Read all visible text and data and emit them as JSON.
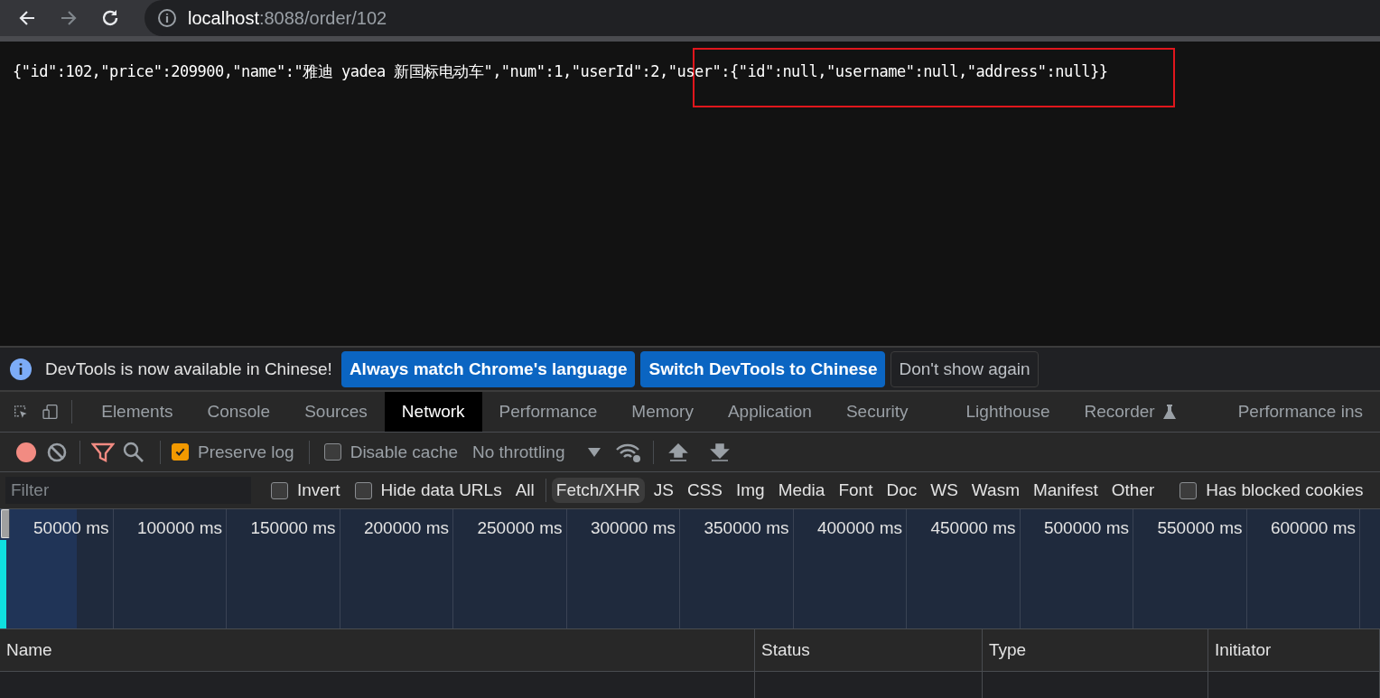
{
  "browser": {
    "address": {
      "host": "localhost",
      "path": ":8088/order/102"
    }
  },
  "page": {
    "response_text": "{\"id\":102,\"price\":209900,\"name\":\"雅迪 yadea 新国标电动车\",\"num\":1,\"userId\":2,\"user\":{\"id\":null,\"username\":null,\"address\":null}}"
  },
  "devtools": {
    "infobar": {
      "message": "DevTools is now available in Chinese!",
      "buttons": [
        {
          "label": "Always match Chrome's language",
          "kind": "primary"
        },
        {
          "label": "Switch DevTools to Chinese",
          "kind": "primary"
        },
        {
          "label": "Don't show again",
          "kind": "secondary"
        }
      ]
    },
    "tabs": [
      {
        "label": "Elements",
        "selected": false
      },
      {
        "label": "Console",
        "selected": false
      },
      {
        "label": "Sources",
        "selected": false
      },
      {
        "label": "Network",
        "selected": true
      },
      {
        "label": "Performance",
        "selected": false
      },
      {
        "label": "Memory",
        "selected": false
      },
      {
        "label": "Application",
        "selected": false
      },
      {
        "label": "Security",
        "selected": false
      },
      {
        "label": "Lighthouse",
        "selected": false
      },
      {
        "label": "Recorder",
        "selected": false,
        "experimental": true
      },
      {
        "label": "Performance ins",
        "selected": false
      }
    ],
    "toolbar": {
      "recording": true,
      "filter_shown": true,
      "preserve_log": {
        "label": "Preserve log",
        "checked": true
      },
      "disable_cache": {
        "label": "Disable cache",
        "checked": false
      },
      "throttling": "No throttling"
    },
    "filter_bar": {
      "placeholder": "Filter",
      "invert": {
        "label": "Invert",
        "checked": false
      },
      "hide_data_urls": {
        "label": "Hide data URLs",
        "checked": false
      },
      "types": [
        {
          "label": "All",
          "selected": false
        },
        {
          "label": "Fetch/XHR",
          "selected": true
        },
        {
          "label": "JS",
          "selected": false
        },
        {
          "label": "CSS",
          "selected": false
        },
        {
          "label": "Img",
          "selected": false
        },
        {
          "label": "Media",
          "selected": false
        },
        {
          "label": "Font",
          "selected": false
        },
        {
          "label": "Doc",
          "selected": false
        },
        {
          "label": "WS",
          "selected": false
        },
        {
          "label": "Wasm",
          "selected": false
        },
        {
          "label": "Manifest",
          "selected": false
        },
        {
          "label": "Other",
          "selected": false
        }
      ],
      "has_blocked_cookies": {
        "label": "Has blocked cookies",
        "checked": false
      }
    },
    "timeline": {
      "ticks": [
        "50000 ms",
        "100000 ms",
        "150000 ms",
        "200000 ms",
        "250000 ms",
        "300000 ms",
        "350000 ms",
        "400000 ms",
        "450000 ms",
        "500000 ms",
        "550000 ms",
        "600000 ms"
      ]
    },
    "table": {
      "columns": [
        "Name",
        "Status",
        "Type",
        "Initiator"
      ]
    }
  }
}
